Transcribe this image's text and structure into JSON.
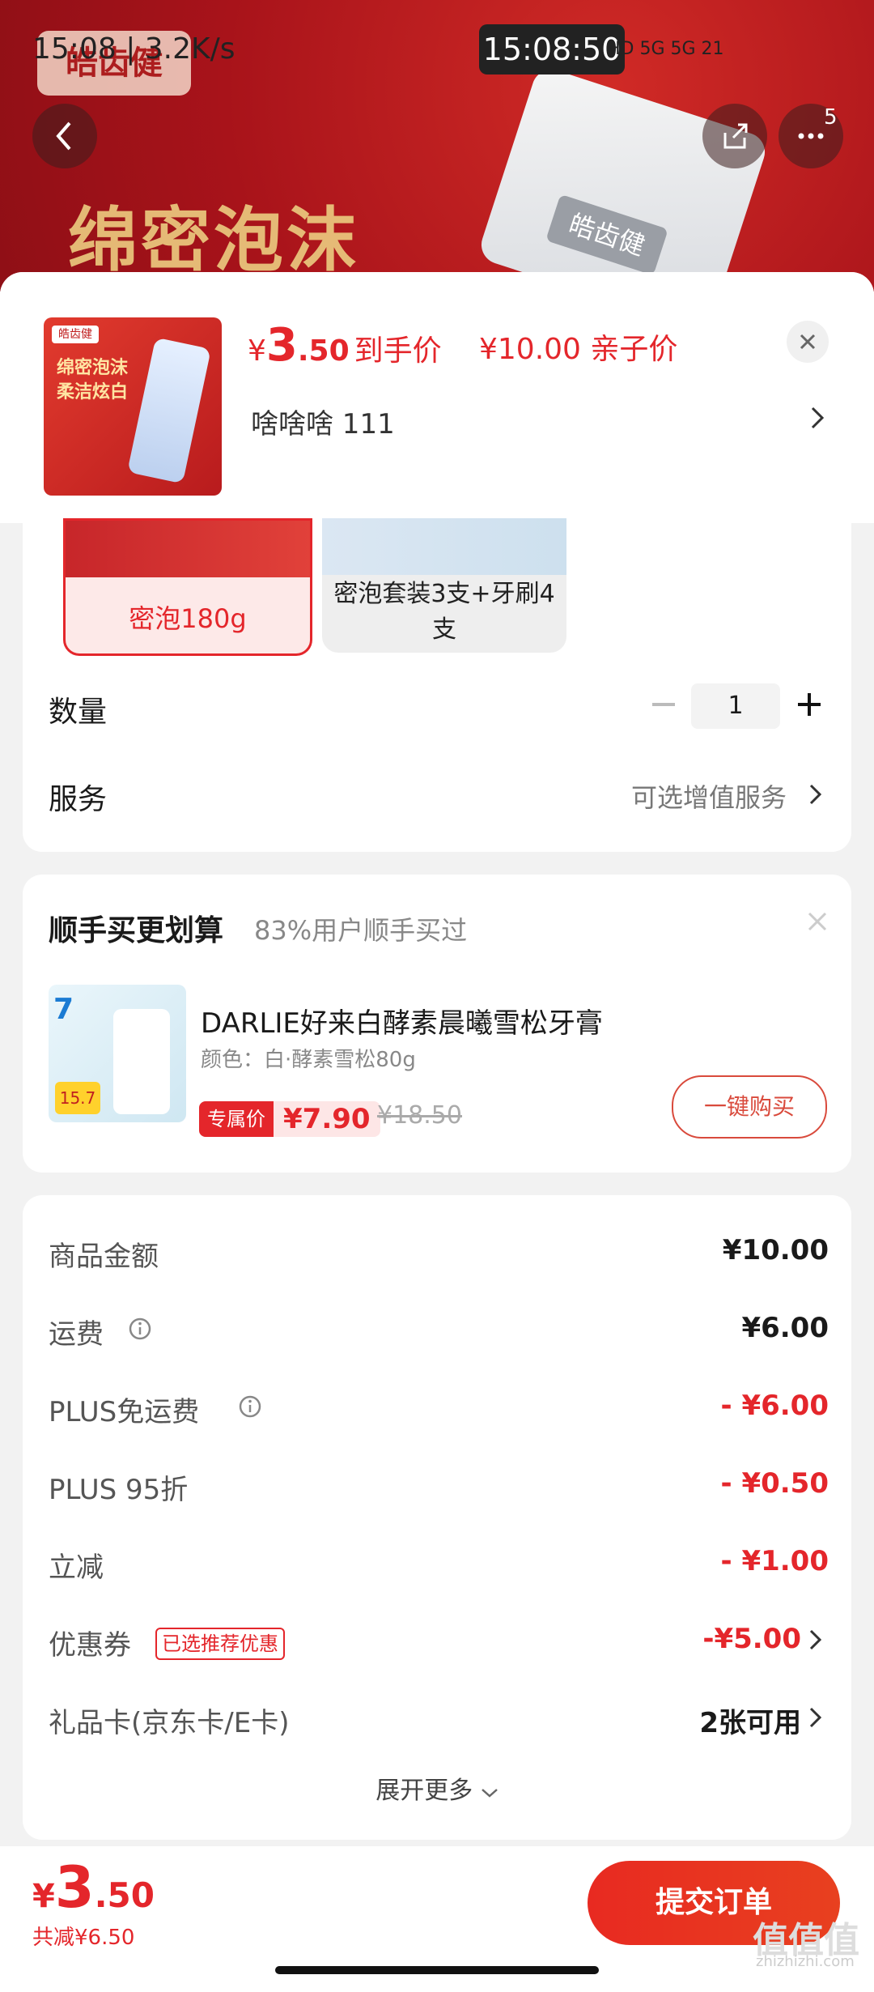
{
  "status_bar": {
    "left": "15:08 | 3.2K/s",
    "clock": "15:08:50",
    "right": "HD 5G 5G 21"
  },
  "banner": {
    "logo_text": "皓齿健",
    "slogan": "绵密泡沫",
    "tube_label": "皓齿健",
    "more_badge": "5"
  },
  "product": {
    "thumb_tag": "皓齿健",
    "thumb_text_1": "绵密泡沫",
    "thumb_text_2": "柔洁炫白",
    "price_yen": "¥",
    "price_int": "3",
    "price_dec": ".50",
    "price_label": "到手价",
    "member_price": "¥10.00 亲子价",
    "address": "啥啥啥  111"
  },
  "options": [
    {
      "label": "密泡180g",
      "selected": true
    },
    {
      "label": "密泡套装3支+牙刷4支",
      "selected": false
    }
  ],
  "quantity": {
    "label": "数量",
    "value": "1"
  },
  "service": {
    "label": "服务",
    "value": "可选增值服务"
  },
  "bundle": {
    "title": "顺手买更划算",
    "subtitle": "83%用户顺手买过",
    "thumb_badge": "7",
    "thumb_price": "15.7",
    "name": "DARLIE好来白酵素晨曦雪松牙膏",
    "spec": "颜色：白·酵素雪松80g",
    "tag": "专属价",
    "price": "¥7.90",
    "old_price": "¥18.50",
    "buy_label": "一键购买"
  },
  "summary": {
    "rows": [
      {
        "label": "商品金额",
        "value": "¥10.00"
      },
      {
        "label": "运费",
        "value": "¥6.00"
      },
      {
        "label": "PLUS免运费",
        "value": "- ¥6.00"
      },
      {
        "label": "PLUS 95折",
        "value": "- ¥0.50"
      },
      {
        "label": "立减",
        "value": "- ¥1.00"
      },
      {
        "label": "优惠券",
        "value": "-¥5.00"
      },
      {
        "label": "礼品卡(京东卡/E卡)",
        "value": "2张可用"
      }
    ],
    "coupon_tag": "已选推荐优惠",
    "expand": "展开更多"
  },
  "bottom": {
    "yen": "¥",
    "int": "3",
    "dec": ".50",
    "discount": "共减¥6.50",
    "submit": "提交订单"
  },
  "watermark": {
    "main": "值值值",
    "sub": "zhizhizhi.com"
  },
  "colors": {
    "accent": "#e4262b",
    "banner": "#a8131a"
  }
}
